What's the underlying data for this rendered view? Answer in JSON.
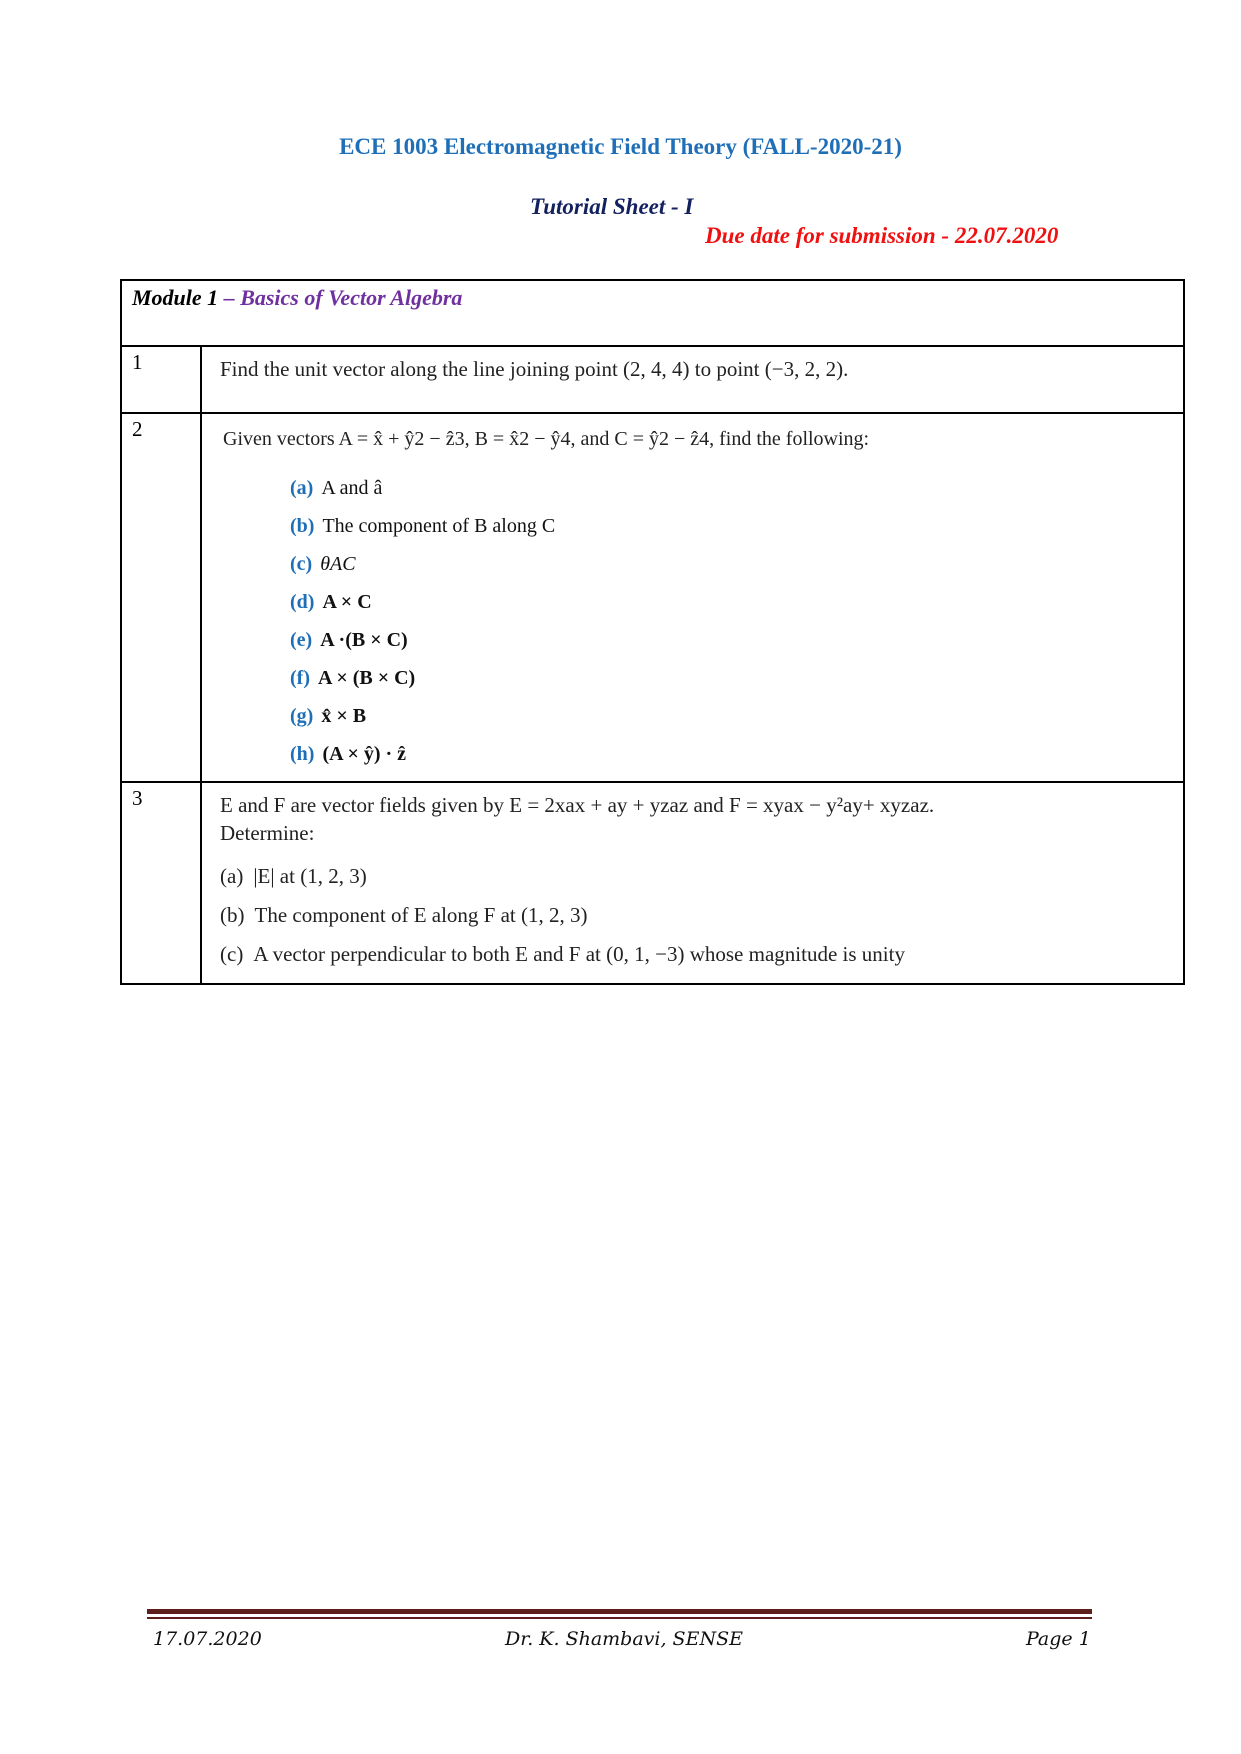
{
  "header": {
    "course_title": "ECE 1003  Electromagnetic Field Theory (FALL-2020-21)",
    "sheet_title": "Tutorial Sheet - I",
    "due_date": "Due date for submission - 22.07.2020"
  },
  "colors": {
    "course_title": "#1f6fb8",
    "sheet_title": "#14215f",
    "due_date": "#f01010",
    "module_topic": "#7030a0",
    "part_label": "#1f6fb8",
    "footer_rule": "#5c1f1c"
  },
  "module": {
    "label": "Module 1",
    "topic": " – Basics of Vector Algebra"
  },
  "questions": [
    {
      "number": "1",
      "text": "Find the unit vector along the line joining point (2, 4, 4) to point (−3, 2, 2)."
    },
    {
      "number": "2",
      "text": "Given  vectors  A = x̂ + ŷ2 − ẑ3,    B = x̂2 − ŷ4,  and C = ŷ2 − ẑ4, find the following:",
      "parts": [
        {
          "label": "(a)",
          "text": "A and â"
        },
        {
          "label": "(b)",
          "text": "The component of B along C"
        },
        {
          "label": "(c)",
          "text": "θAC"
        },
        {
          "label": "(d)",
          "text": "A × C"
        },
        {
          "label": "(e)",
          "text": "A ·(B × C)"
        },
        {
          "label": "(f)",
          "text": "A × (B × C)"
        },
        {
          "label": "(g)",
          "text": "x̂ × B"
        },
        {
          "label": "(h)",
          "text": "(A × ŷ) · ẑ"
        }
      ]
    },
    {
      "number": "3",
      "text": "E and F are vector fields given by E = 2xax + ay + yzaz and F = xyax − y²ay+ xyzaz.",
      "subtext": "Determine:",
      "parts": [
        {
          "label": "(a)",
          "text": "|E| at (1, 2, 3)"
        },
        {
          "label": "(b)",
          "text": "The component of E along F at (1, 2, 3)"
        },
        {
          "label": "(c)",
          "text": "A vector perpendicular to both E and F at (0, 1, −3) whose magnitude is unity"
        }
      ]
    }
  ],
  "footer": {
    "date": "17.07.2020",
    "author": "Dr. K. Shambavi,   SENSE",
    "page": "Page 1"
  }
}
